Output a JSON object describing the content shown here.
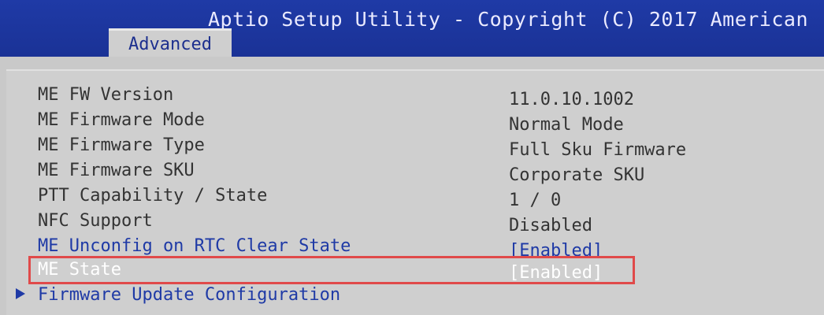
{
  "header": {
    "title": "Aptio Setup Utility - Copyright (C) 2017 American",
    "active_tab": "Advanced"
  },
  "rows": [
    {
      "label": "ME FW Version",
      "value": "11.0.10.1002"
    },
    {
      "label": "ME Firmware Mode",
      "value": "Normal Mode"
    },
    {
      "label": "ME Firmware Type",
      "value": "Full Sku Firmware"
    },
    {
      "label": "ME Firmware SKU",
      "value": "Corporate SKU"
    },
    {
      "label": "PTT Capability / State",
      "value": "1 / 0"
    },
    {
      "label": "NFC Support",
      "value": "Disabled"
    },
    {
      "label": "ME Unconfig on RTC Clear State",
      "value": "[Enabled]"
    },
    {
      "label": "ME State",
      "value": "[Enabled]"
    },
    {
      "label": "Firmware Update Configuration",
      "value": ""
    }
  ],
  "colors": {
    "header_blue": "#1f3aa6",
    "panel_gray": "#cfcfcf",
    "highlight_red": "#e04a4a"
  }
}
